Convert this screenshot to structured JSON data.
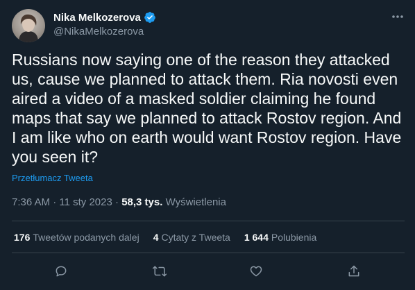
{
  "author": {
    "name": "Nika Melkozerova",
    "handle": "@NikaMelkozerova",
    "verified": true
  },
  "tweet": {
    "text": "Russians now saying one of the reason they attacked\nus, cause we planned to attack them. Ria novosti even\naired a video of a masked soldier claiming he found\nmaps that say we planned to attack Rostov region. And\nI am like who on earth would want Rostov region. Have\nyou seen it?",
    "translate_label": "Przetłumacz Tweeta"
  },
  "meta": {
    "time": "7:36 AM",
    "separator": "·",
    "date": "11 sty 2023",
    "views_count": "58,3 tys.",
    "views_label": "Wyświetlenia"
  },
  "stats": {
    "retweets_count": "176",
    "retweets_label": "Tweetów podanych dalej",
    "quotes_count": "4",
    "quotes_label": "Cytaty z Tweeta",
    "likes_count": "1 644",
    "likes_label": "Polubienia"
  },
  "icons": {
    "more": "more-icon",
    "reply": "reply-icon",
    "retweet": "retweet-icon",
    "like": "heart-icon",
    "share": "share-icon",
    "verified": "verified-badge-icon"
  },
  "colors": {
    "background": "#15202b",
    "text": "#f7f9f9",
    "secondary": "#8b98a5",
    "accent": "#1d9bf0",
    "divider": "#38444d"
  }
}
